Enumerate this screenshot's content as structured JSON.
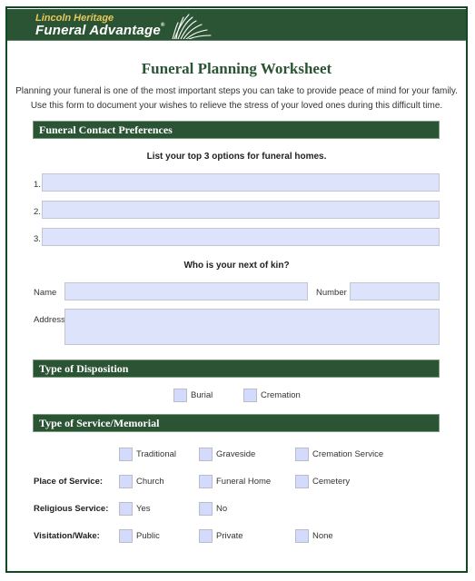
{
  "brand": {
    "line1": "Lincoln Heritage",
    "line2": "Funeral Advantage",
    "registered_mark": "®",
    "colors": {
      "primary_green": "#2b5434",
      "frame_green": "#0e4a22",
      "gold": "#e8c85a",
      "field_fill": "#dde3fb"
    }
  },
  "title": "Funeral Planning Worksheet",
  "intro": {
    "line1": "Planning your funeral is one of the most important steps you can take to provide peace of mind for your family.",
    "line2": "Use this form to document your wishes to relieve the stress of your loved ones during this difficult time."
  },
  "sections": {
    "contact": {
      "title": "Funeral Contact Preferences",
      "homes_prompt": "List your top 3 options for funeral homes.",
      "homes": [
        {
          "label": "1.",
          "value": ""
        },
        {
          "label": "2.",
          "value": ""
        },
        {
          "label": "3.",
          "value": ""
        }
      ],
      "kin_prompt": "Who is your next of kin?",
      "kin": {
        "name_label": "Name",
        "name_value": "",
        "number_label": "Number",
        "number_value": "",
        "address_label": "Address",
        "address_value": ""
      }
    },
    "disposition": {
      "title": "Type of Disposition",
      "options": [
        {
          "label": "Burial",
          "checked": false
        },
        {
          "label": "Cremation",
          "checked": false
        }
      ]
    },
    "service": {
      "title": "Type of Service/Memorial",
      "rows": [
        {
          "label": "",
          "options": [
            {
              "label": "Traditional",
              "checked": false
            },
            {
              "label": "Graveside",
              "checked": false
            },
            {
              "label": "Cremation Service",
              "checked": false
            }
          ]
        },
        {
          "label": "Place of Service:",
          "options": [
            {
              "label": "Church",
              "checked": false
            },
            {
              "label": "Funeral Home",
              "checked": false
            },
            {
              "label": "Cemetery",
              "checked": false
            }
          ]
        },
        {
          "label": "Religious Service:",
          "options": [
            {
              "label": "Yes",
              "checked": false
            },
            {
              "label": "No",
              "checked": false
            }
          ]
        },
        {
          "label": "Visitation/Wake:",
          "options": [
            {
              "label": "Public",
              "checked": false
            },
            {
              "label": "Private",
              "checked": false
            },
            {
              "label": "None",
              "checked": false
            }
          ]
        }
      ]
    }
  }
}
